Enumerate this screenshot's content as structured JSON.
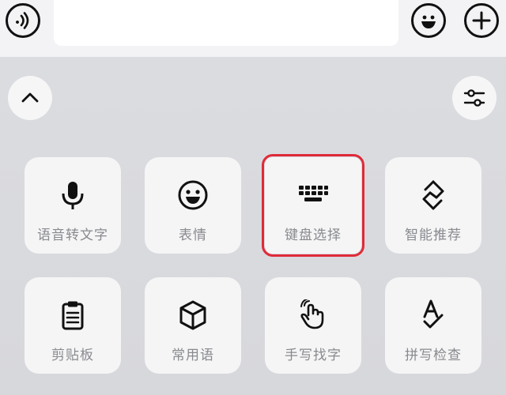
{
  "input": {
    "placeholder": ""
  },
  "icons": {
    "voice_toggle": "voice-wave-icon",
    "emoji": "smiley-icon",
    "plus": "plus-icon",
    "collapse": "chevron-up-icon",
    "settings": "sliders-icon"
  },
  "accent_color": "#e02a38",
  "tiles": [
    {
      "label": "语音转文字",
      "icon": "microphone-icon"
    },
    {
      "label": "表情",
      "icon": "smiley-icon"
    },
    {
      "label": "键盘选择",
      "icon": "keyboard-icon",
      "selected": true
    },
    {
      "label": "智能推荐",
      "icon": "diamond-s-icon"
    },
    {
      "label": "剪贴板",
      "icon": "clipboard-icon"
    },
    {
      "label": "常用语",
      "icon": "cube-icon"
    },
    {
      "label": "手写找字",
      "icon": "hand-pointer-icon"
    },
    {
      "label": "拼写检查",
      "icon": "spell-check-icon"
    }
  ]
}
